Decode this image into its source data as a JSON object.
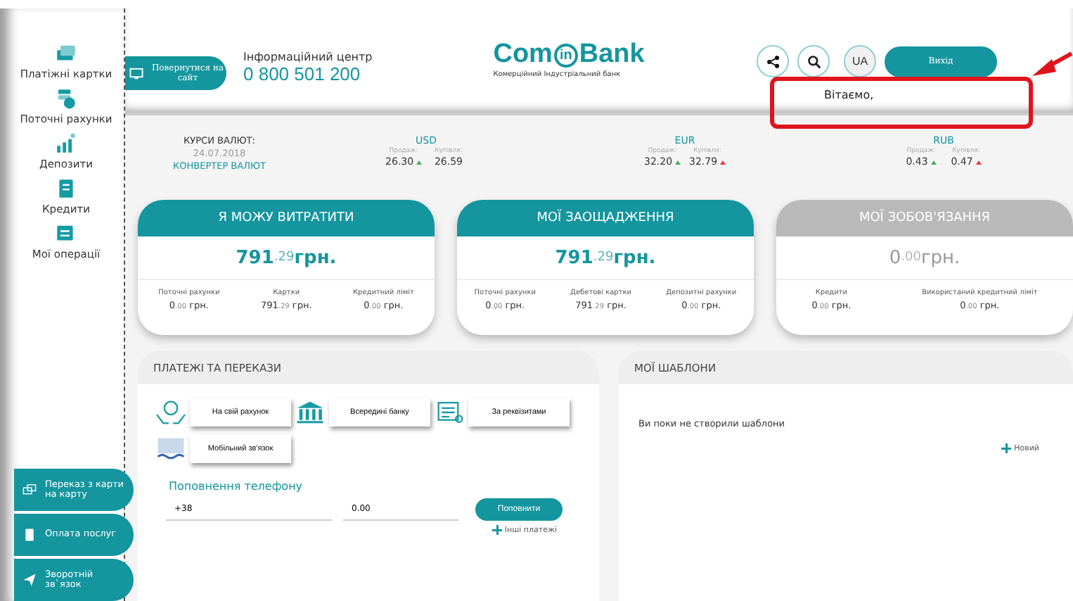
{
  "sidebar": {
    "items": [
      {
        "label": "Платіжні картки",
        "kind": "cards"
      },
      {
        "label": "Поточні рахунки",
        "kind": "coins"
      },
      {
        "label": "Депозити",
        "kind": "growth"
      },
      {
        "label": "Кредити",
        "kind": "document"
      },
      {
        "label": "Мої операції",
        "kind": "list"
      }
    ],
    "quick_actions": [
      {
        "label": "Переказ з карти на карту",
        "kind": "cards"
      },
      {
        "label": "Оплата послуг",
        "kind": "receipt"
      },
      {
        "label": "Зворотній зв`язок",
        "kind": "send"
      }
    ]
  },
  "header": {
    "back_button": "Повернутися на сайт",
    "info_title": "Інформаційний центр",
    "phone": "0 800 501 200",
    "logo": {
      "left": "Com",
      "mid": "in",
      "right": "Bank",
      "subtitle": "Комерційний Індустріальний банк"
    },
    "language": "UA",
    "logout": "Вихід",
    "greeting": "Вітаємо,"
  },
  "rates": {
    "title": "КУРСИ ВАЛЮТ:",
    "date": "24.07.2018",
    "converter": "КОНВЕРТЕР ВАЛЮТ",
    "currencies": [
      {
        "code": "USD",
        "sell_label": "Продаж:",
        "buy_label": "Купівля:",
        "sell": {
          "value": "26.30",
          "color": "#4caf50"
        },
        "buy": {
          "value": "26.59"
        }
      },
      {
        "code": "EUR",
        "sell_label": "Продаж:",
        "buy_label": "Купівля:",
        "sell": {
          "value": "32.20",
          "color": "#4caf50"
        },
        "buy": {
          "value": "32.79",
          "color": "#e53935"
        }
      },
      {
        "code": "RUB",
        "sell_label": "Продаж:",
        "buy_label": "Купівля:",
        "sell": {
          "value": "0.43",
          "color": "#4caf50"
        },
        "buy": {
          "value": "0.47",
          "color": "#e53935"
        }
      }
    ]
  },
  "cards": [
    {
      "title": "Я МОЖУ ВИТРАТИТИ",
      "kind": "active",
      "amount": {
        "whole": "791",
        "cents": ".29",
        "currency": "грн."
      },
      "items": [
        {
          "label": "Поточні рахунки",
          "whole": "0",
          "cents": ".00",
          "currency": "грн."
        },
        {
          "label": "Картки",
          "whole": "791",
          "cents": ".29",
          "currency": "грн."
        },
        {
          "label": "Кредитний ліміт",
          "whole": "0",
          "cents": ".00",
          "currency": "грн."
        }
      ]
    },
    {
      "title": "МОЇ ЗАОЩАДЖЕННЯ",
      "kind": "active",
      "amount": {
        "whole": "791",
        "cents": ".29",
        "currency": "грн."
      },
      "items": [
        {
          "label": "Поточні рахунки",
          "whole": "0",
          "cents": ".00",
          "currency": "грн."
        },
        {
          "label": "Дебетові картки",
          "whole": "791",
          "cents": ".29",
          "currency": "грн."
        },
        {
          "label": "Депозитні рахунки",
          "whole": "0",
          "cents": ".00",
          "currency": "грн."
        }
      ]
    },
    {
      "title": "МОЇ ЗОБОВ'ЯЗАННЯ",
      "kind": "inactive",
      "amount": {
        "whole": "0",
        "cents": ".00",
        "currency": "грн."
      },
      "items": [
        {
          "label": "Кредити",
          "whole": "0",
          "cents": ".00",
          "currency": "грн."
        },
        {
          "label": "Використаний кредитний ліміт",
          "whole": "0",
          "cents": ".00",
          "currency": "грн."
        }
      ]
    }
  ],
  "payments": {
    "title": "ПЛАТЕЖІ ТА ПЕРЕКАЗИ",
    "options": [
      {
        "label": "На свій рахунок",
        "kind": "hands"
      },
      {
        "label": "Всередині банку",
        "kind": "bank"
      },
      {
        "label": "За реквізитами",
        "kind": "form"
      },
      {
        "label": "Мобільний зв'язок",
        "kind": "mobile"
      }
    ],
    "topup_title": "Поповнення телефону",
    "phone_value": "+38",
    "amount_value": "0.00",
    "topup_button": "Поповнити",
    "other_link": "Інші платежі"
  },
  "templates": {
    "title": "МОЇ ШАБЛОНИ",
    "empty_text": "Ви поки не створили шаблони",
    "new_link": "Новий"
  }
}
